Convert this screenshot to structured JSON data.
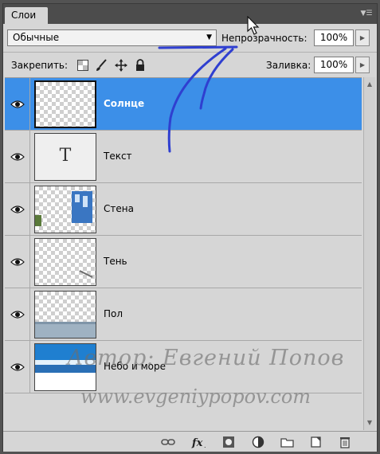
{
  "panel": {
    "tab_label": "Слои",
    "menu_icon": "panel-menu-icon"
  },
  "blend_mode": {
    "value": "Обычные"
  },
  "opacity": {
    "label": "Непрозрачность:",
    "value": "100%"
  },
  "lock": {
    "label": "Закрепить:"
  },
  "fill": {
    "label": "Заливка:",
    "value": "100%"
  },
  "layers": [
    {
      "name": "Солнце",
      "selected": true,
      "visible": true
    },
    {
      "name": "Текст",
      "selected": false,
      "visible": true,
      "thumb_glyph": "T"
    },
    {
      "name": "Стена",
      "selected": false,
      "visible": true
    },
    {
      "name": "Тень",
      "selected": false,
      "visible": true
    },
    {
      "name": "Пол",
      "selected": false,
      "visible": true
    },
    {
      "name": "Небо и море",
      "selected": false,
      "visible": true
    }
  ],
  "watermark": {
    "line1": "Автор: Евгений Попов",
    "line2": "www.evgeniypopov.com"
  },
  "colors": {
    "selected_row": "#3c8fe8",
    "panel_bg": "#d6d6d6",
    "annotation_stroke": "#2f3fd0"
  }
}
